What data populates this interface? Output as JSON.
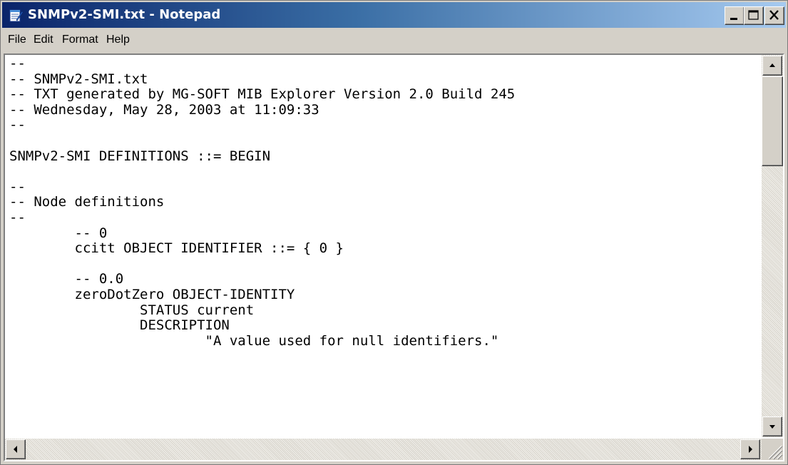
{
  "window": {
    "title": "SNMPv2-SMI.txt - Notepad"
  },
  "menu": {
    "items": [
      "File",
      "Edit",
      "Format",
      "Help"
    ]
  },
  "document": {
    "lines": [
      "--",
      "-- SNMPv2-SMI.txt",
      "-- TXT generated by MG-SOFT MIB Explorer Version 2.0 Build 245",
      "-- Wednesday, May 28, 2003 at 11:09:33",
      "--",
      "",
      "SNMPv2-SMI DEFINITIONS ::= BEGIN",
      "",
      "--",
      "-- Node definitions",
      "--",
      "        -- 0",
      "        ccitt OBJECT IDENTIFIER ::= { 0 }",
      "",
      "        -- 0.0",
      "        zeroDotZero OBJECT-IDENTITY",
      "                STATUS current",
      "                DESCRIPTION",
      "                        \"A value used for null identifiers.\""
    ]
  },
  "icons": {
    "app": "notepad-icon",
    "minimize": "minimize-icon",
    "maximize": "maximize-icon",
    "close": "close-icon"
  }
}
